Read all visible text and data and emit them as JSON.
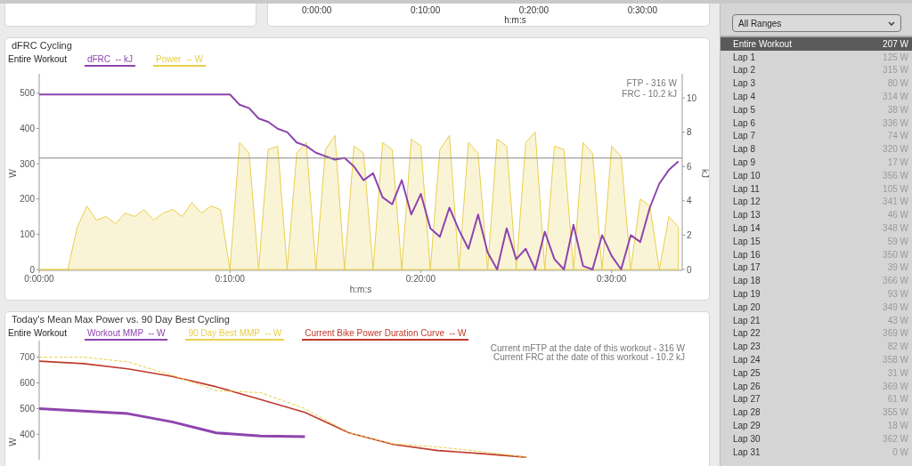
{
  "top_panel": {
    "xticks": [
      "0:00:00",
      "0:10:00",
      "0:20:00",
      "0:30:00"
    ],
    "xlabel": "h:m:s"
  },
  "dfrc_panel": {
    "title": "dFRC Cycling",
    "range_label": "Entire Workout",
    "chart_data": {
      "type": "line",
      "xlabel": "h:m:s",
      "ylabel": "W",
      "y2label": "kJ",
      "x": [
        0,
        0.5,
        1,
        1.5,
        2,
        2.5,
        3,
        3.5,
        4,
        4.5,
        5,
        5.5,
        6,
        6.5,
        7,
        7.5,
        8,
        8.5,
        9,
        9.5,
        10,
        10.5,
        11,
        11.5,
        12,
        12.5,
        13,
        13.5,
        14,
        14.5,
        15,
        15.5,
        16,
        16.5,
        17,
        17.5,
        18,
        18.5,
        19,
        19.5,
        20,
        20.5,
        21,
        21.5,
        22,
        22.5,
        23,
        23.5,
        24,
        24.5,
        25,
        25.5,
        26,
        26.5,
        27,
        27.5,
        28,
        28.5,
        29,
        29.5,
        30,
        30.5,
        31,
        31.5,
        32,
        32.5,
        33,
        33.5
      ],
      "series": [
        {
          "name": "dFRC  -- kJ",
          "color": "#8e44ad",
          "axis": "y2",
          "type": "line",
          "values": [
            10.2,
            10.2,
            10.2,
            10.2,
            10.2,
            10.2,
            10.2,
            10.2,
            10.2,
            10.2,
            10.2,
            10.2,
            10.2,
            10.2,
            10.2,
            10.2,
            10.2,
            10.2,
            10.2,
            10.2,
            10.2,
            9.6,
            9.4,
            8.8,
            8.6,
            8.2,
            8.0,
            7.4,
            7.2,
            6.8,
            6.6,
            6.4,
            6.5,
            6.0,
            5.2,
            5.6,
            4.2,
            3.8,
            5.2,
            3.2,
            4.4,
            2.4,
            1.9,
            3.6,
            2.3,
            1.2,
            3.2,
            1.0,
            0,
            2.4,
            0.6,
            1.2,
            0,
            2.2,
            0.6,
            0,
            2.6,
            0.2,
            0,
            2.0,
            0.8,
            0,
            2.0,
            1.6,
            3.6,
            5.0,
            5.8,
            6.3
          ]
        },
        {
          "name": "Power  -- W",
          "color": "#e8cf4a",
          "type": "area",
          "values": [
            0,
            0,
            0,
            0,
            120,
            180,
            140,
            150,
            130,
            160,
            150,
            170,
            140,
            160,
            170,
            150,
            190,
            160,
            180,
            170,
            0,
            360,
            330,
            0,
            340,
            350,
            0,
            330,
            360,
            0,
            340,
            380,
            0,
            350,
            330,
            0,
            360,
            340,
            0,
            370,
            350,
            0,
            340,
            380,
            0,
            360,
            330,
            0,
            370,
            350,
            0,
            360,
            390,
            0,
            350,
            340,
            0,
            360,
            330,
            0,
            350,
            320,
            0,
            200,
            180,
            0,
            150,
            120
          ]
        }
      ],
      "xlim": [
        0,
        33.7
      ],
      "ylim": [
        0,
        555
      ],
      "y2lim": [
        0,
        11.4
      ],
      "xticks": [
        {
          "value": 0,
          "label": "0:00:00"
        },
        {
          "value": 10,
          "label": "0:10:00"
        },
        {
          "value": 20,
          "label": "0:20:00"
        },
        {
          "value": 30,
          "label": "0:30:00"
        }
      ],
      "yticks": [
        0,
        100,
        200,
        300,
        400,
        500
      ],
      "y2ticks": [
        0,
        2,
        4,
        6,
        8,
        10
      ],
      "ref_lines": [
        {
          "axis": "y",
          "value": 316,
          "label": "FTP - 316 W"
        }
      ],
      "annotations": [
        "FRC - 10.2 kJ"
      ]
    }
  },
  "mmp_panel": {
    "title": "Today's Mean Max Power vs. 90 Day Best Cycling",
    "range_label": "Entire Workout",
    "chart_data": {
      "type": "line",
      "ylabel": "W",
      "series": [
        {
          "name": "Workout MMP  -- W",
          "color": "#8e44ad",
          "line_style": "solid",
          "values": [
            500,
            490,
            480,
            448,
            405,
            393,
            390,
            null,
            null,
            null,
            null,
            null
          ]
        },
        {
          "name": "90 Day Best MMP  -- W",
          "color": "#e8cf4a",
          "line_style": "dashed",
          "values": [
            700,
            700,
            682,
            630,
            570,
            562,
            500,
            405,
            362,
            350,
            332,
            310
          ]
        },
        {
          "name": "Current Bike Power Duration Curve  -- W",
          "color": "#c0392b",
          "line_style": "solid",
          "values": [
            685,
            675,
            655,
            625,
            585,
            535,
            485,
            405,
            360,
            336,
            324,
            310
          ]
        }
      ],
      "ylim": [
        300,
        765
      ],
      "yticks": [
        400,
        500,
        600,
        700
      ],
      "annotations": [
        "Current mFTP at the date of this workout - 316 W",
        "Current FRC at the date of this workout - 10.2 kJ"
      ]
    }
  },
  "sidebar": {
    "range_select": {
      "value": "All Ranges"
    },
    "ranges": [
      {
        "name": "Entire Workout",
        "value": "207 W",
        "selected": true
      },
      {
        "name": "Lap 1",
        "value": "125 W",
        "selected": false
      },
      {
        "name": "Lap 2",
        "value": "315 W",
        "selected": false
      },
      {
        "name": "Lap 3",
        "value": "80 W",
        "selected": false
      },
      {
        "name": "Lap 4",
        "value": "314 W",
        "selected": false
      },
      {
        "name": "Lap 5",
        "value": "38 W",
        "selected": false
      },
      {
        "name": "Lap 6",
        "value": "336 W",
        "selected": false
      },
      {
        "name": "Lap 7",
        "value": "74 W",
        "selected": false
      },
      {
        "name": "Lap 8",
        "value": "320 W",
        "selected": false
      },
      {
        "name": "Lap 9",
        "value": "17 W",
        "selected": false
      },
      {
        "name": "Lap 10",
        "value": "356 W",
        "selected": false
      },
      {
        "name": "Lap 11",
        "value": "105 W",
        "selected": false
      },
      {
        "name": "Lap 12",
        "value": "341 W",
        "selected": false
      },
      {
        "name": "Lap 13",
        "value": "46 W",
        "selected": false
      },
      {
        "name": "Lap 14",
        "value": "348 W",
        "selected": false
      },
      {
        "name": "Lap 15",
        "value": "59 W",
        "selected": false
      },
      {
        "name": "Lap 16",
        "value": "350 W",
        "selected": false
      },
      {
        "name": "Lap 17",
        "value": "39 W",
        "selected": false
      },
      {
        "name": "Lap 18",
        "value": "366 W",
        "selected": false
      },
      {
        "name": "Lap 19",
        "value": "93 W",
        "selected": false
      },
      {
        "name": "Lap 20",
        "value": "349 W",
        "selected": false
      },
      {
        "name": "Lap 21",
        "value": "43 W",
        "selected": false
      },
      {
        "name": "Lap 22",
        "value": "369 W",
        "selected": false
      },
      {
        "name": "Lap 23",
        "value": "82 W",
        "selected": false
      },
      {
        "name": "Lap 24",
        "value": "358 W",
        "selected": false
      },
      {
        "name": "Lap 25",
        "value": "31 W",
        "selected": false
      },
      {
        "name": "Lap 26",
        "value": "369 W",
        "selected": false
      },
      {
        "name": "Lap 27",
        "value": "61 W",
        "selected": false
      },
      {
        "name": "Lap 28",
        "value": "355 W",
        "selected": false
      },
      {
        "name": "Lap 29",
        "value": "18 W",
        "selected": false
      },
      {
        "name": "Lap 30",
        "value": "362 W",
        "selected": false
      },
      {
        "name": "Lap 31",
        "value": "0 W",
        "selected": false
      }
    ]
  }
}
